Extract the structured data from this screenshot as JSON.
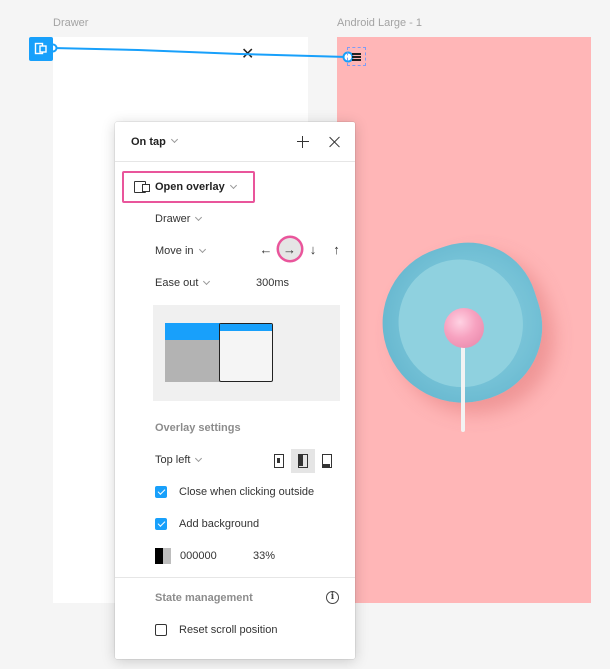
{
  "canvas": {
    "frames": [
      {
        "label": "Drawer",
        "color": "#ffffff"
      },
      {
        "label": "Android Large - 1",
        "color": "#ffb6b7"
      }
    ],
    "connector_color": "#18a0fb"
  },
  "panel": {
    "trigger": "On tap",
    "action": "Open overlay",
    "destination": "Drawer",
    "animation": "Move in",
    "directions": [
      {
        "icon": "arrow-left-icon",
        "glyph": "←",
        "selected": false
      },
      {
        "icon": "arrow-right-icon",
        "glyph": "→",
        "selected": true
      },
      {
        "icon": "arrow-down-icon",
        "glyph": "↓",
        "selected": false
      },
      {
        "icon": "arrow-up-icon",
        "glyph": "↑",
        "selected": false
      }
    ],
    "easing": "Ease out",
    "duration": "300ms",
    "overlay_settings": {
      "title": "Overlay settings",
      "position": "Top left",
      "position_options": [
        "center",
        "left",
        "bottom"
      ],
      "close_when_clicking_outside": {
        "label": "Close when clicking outside",
        "checked": true
      },
      "add_background": {
        "label": "Add background",
        "checked": true
      },
      "background_color": "000000",
      "background_opacity": "33%"
    },
    "state_management": {
      "title": "State management",
      "reset_scroll_position": {
        "label": "Reset scroll position",
        "checked": false
      }
    }
  },
  "colors": {
    "accent": "#18a0fb",
    "highlight": "#e9559b"
  }
}
